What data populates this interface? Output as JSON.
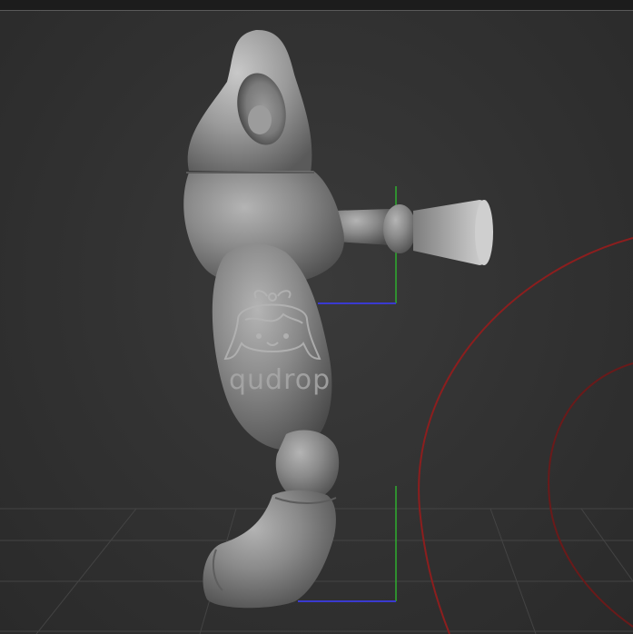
{
  "viewport": {
    "background": "#313131",
    "top_border_color": "#5a5a5a"
  },
  "model": {
    "kind": "sculpted toy figure, side view",
    "material_color": "#808080"
  },
  "watermark": {
    "text": "qudrop",
    "icon": "girl-face-with-bow-icon"
  },
  "gizmo": {
    "y_axis_color": "#2fae2f",
    "z_axis_color": "#3a3ad0"
  },
  "rotation_ring": {
    "color": "#8c1e1e"
  }
}
